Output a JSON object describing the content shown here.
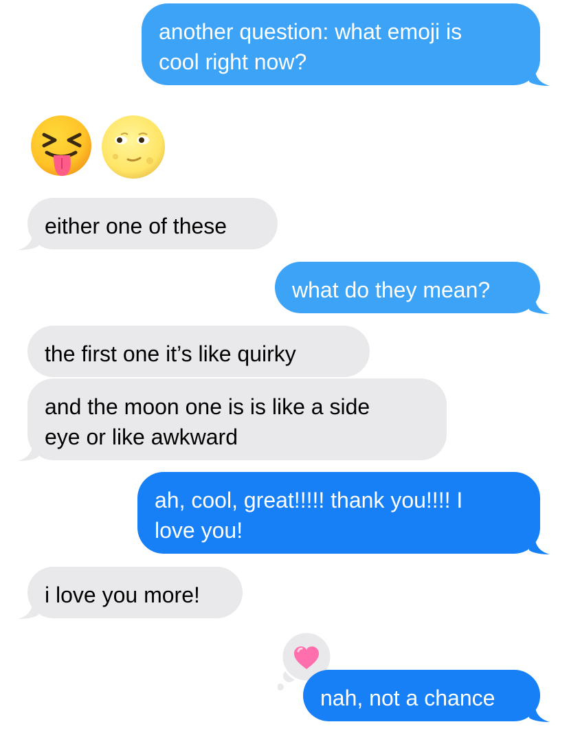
{
  "thread": {
    "messages": [
      {
        "text": "another question: what emoji is\ncool right now?",
        "direction": "outgoing"
      },
      {
        "emoji": [
          "squinting-face-with-tongue",
          "full-moon-face"
        ],
        "direction": "incoming"
      },
      {
        "text": "either one of these",
        "direction": "incoming"
      },
      {
        "text": "what do they mean?",
        "direction": "outgoing"
      },
      {
        "text": "the first one it’s like quirky",
        "direction": "incoming"
      },
      {
        "text": "and the moon one is is like a side\neye or like awkward",
        "direction": "incoming"
      },
      {
        "text": "ah, cool, great!!!!! thank you!!!! I\nlove you!",
        "direction": "outgoing"
      },
      {
        "text": "i love you more!",
        "direction": "incoming"
      },
      {
        "text": "nah, not a chance",
        "direction": "outgoing",
        "reaction": "heart"
      }
    ]
  },
  "colors": {
    "outgoing_light": "#3ca3f6",
    "outgoing": "#1780f6",
    "incoming": "#e9e9eb",
    "reaction_heart": "#ff6fae"
  }
}
